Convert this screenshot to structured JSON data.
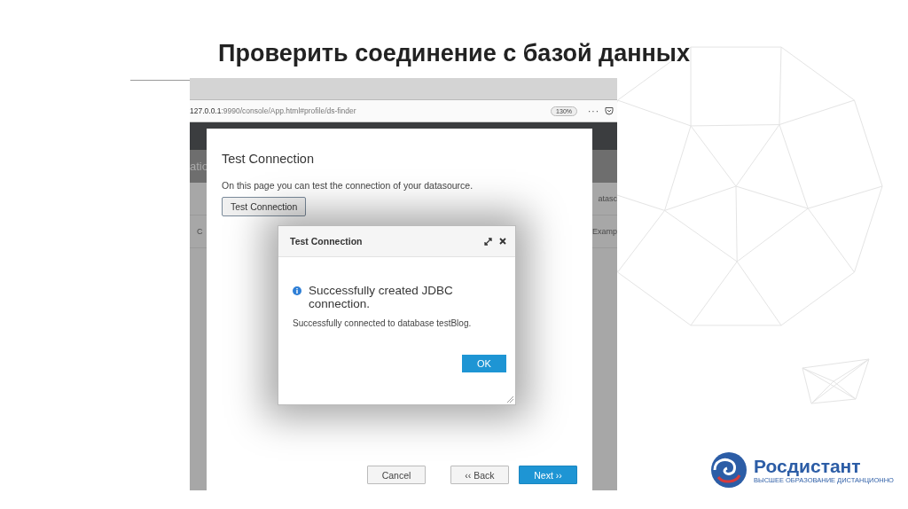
{
  "slide": {
    "title": "Проверить соединение с базой данных"
  },
  "browser": {
    "host": "127.0.0.1",
    "path": ":9990/console/App.html#profile/ds-finder",
    "zoom": "130%",
    "menu": "···"
  },
  "background_app": {
    "header_fragment": "atio",
    "left_fragment": "C",
    "column_fragment": "atasc",
    "cell_fragment": "Examp"
  },
  "wizard": {
    "title": "Test Connection",
    "description": "On this page you can test the connection of your datasource.",
    "test_button": "Test Connection",
    "buttons": [
      {
        "label": "Cancel",
        "kind": "secondary"
      },
      {
        "label": "‹‹ Back",
        "kind": "secondary"
      },
      {
        "label": "Next ››",
        "kind": "primary"
      }
    ]
  },
  "popup": {
    "title": "Test Connection",
    "heading": "Successfully created JDBC connection.",
    "message": "Successfully connected to database testBlog.",
    "ok_button": "OK"
  },
  "logo": {
    "name": "Росдистант",
    "tagline": "ВЫСШЕЕ ОБРАЗОВАНИЕ ДИСТАНЦИОННО"
  }
}
